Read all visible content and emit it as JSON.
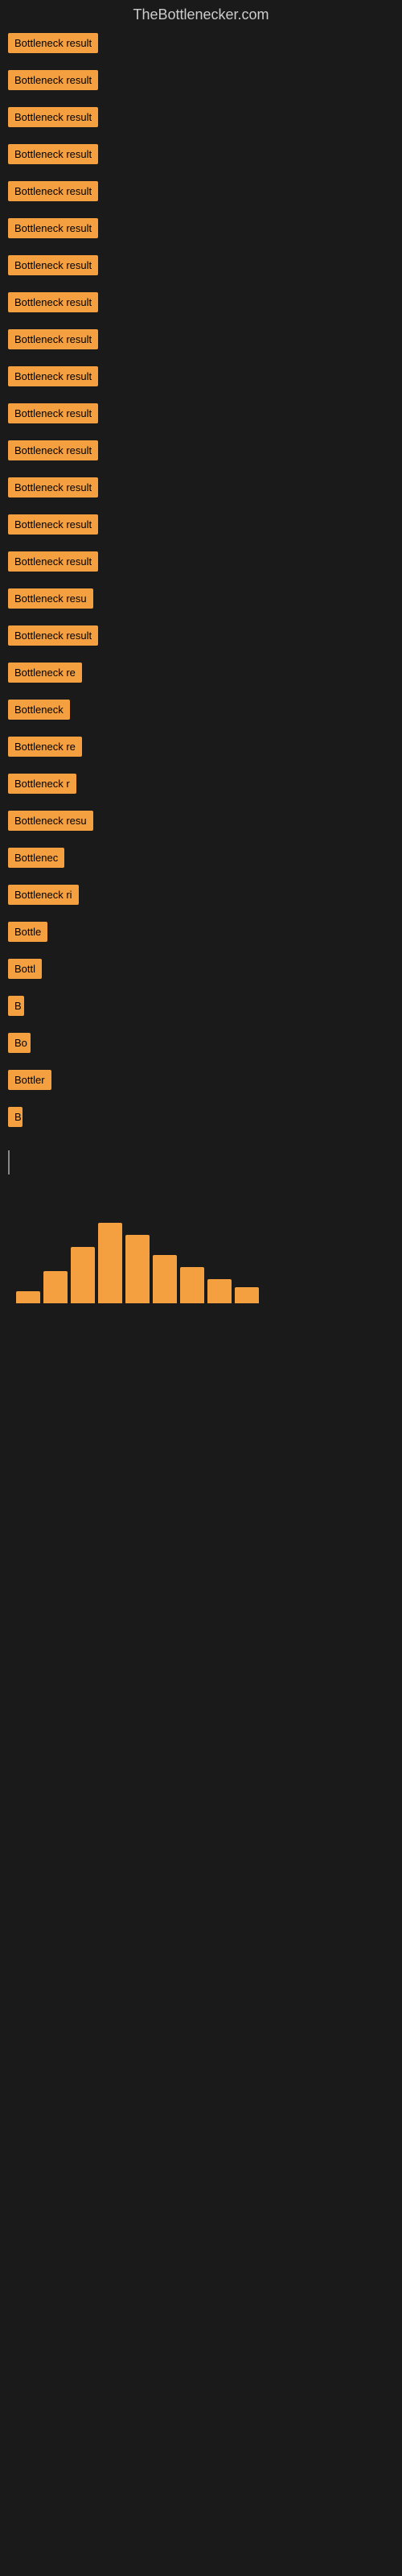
{
  "site": {
    "title": "TheBottlenecker.com"
  },
  "items": [
    {
      "id": 1,
      "label": "Bottleneck result",
      "width": 130,
      "visible_text": "Bottleneck result"
    },
    {
      "id": 2,
      "label": "Bottleneck result",
      "width": 130,
      "visible_text": "Bottleneck result"
    },
    {
      "id": 3,
      "label": "Bottleneck result",
      "width": 130,
      "visible_text": "Bottleneck result"
    },
    {
      "id": 4,
      "label": "Bottleneck result",
      "width": 130,
      "visible_text": "Bottleneck result"
    },
    {
      "id": 5,
      "label": "Bottleneck result",
      "width": 130,
      "visible_text": "Bottleneck result"
    },
    {
      "id": 6,
      "label": "Bottleneck result",
      "width": 130,
      "visible_text": "Bottleneck result"
    },
    {
      "id": 7,
      "label": "Bottleneck result",
      "width": 130,
      "visible_text": "Bottleneck result"
    },
    {
      "id": 8,
      "label": "Bottleneck result",
      "width": 130,
      "visible_text": "Bottleneck result"
    },
    {
      "id": 9,
      "label": "Bottleneck result",
      "width": 130,
      "visible_text": "Bottleneck result"
    },
    {
      "id": 10,
      "label": "Bottleneck result",
      "width": 130,
      "visible_text": "Bottleneck result"
    },
    {
      "id": 11,
      "label": "Bottleneck result",
      "width": 130,
      "visible_text": "Bottleneck result"
    },
    {
      "id": 12,
      "label": "Bottleneck result",
      "width": 130,
      "visible_text": "Bottleneck result"
    },
    {
      "id": 13,
      "label": "Bottleneck result",
      "width": 130,
      "visible_text": "Bottleneck result"
    },
    {
      "id": 14,
      "label": "Bottleneck result",
      "width": 130,
      "visible_text": "Bottleneck result"
    },
    {
      "id": 15,
      "label": "Bottleneck result",
      "width": 130,
      "visible_text": "Bottleneck result"
    },
    {
      "id": 16,
      "label": "Bottleneck resu",
      "width": 110,
      "visible_text": "Bottleneck resu"
    },
    {
      "id": 17,
      "label": "Bottleneck result",
      "width": 130,
      "visible_text": "Bottleneck result"
    },
    {
      "id": 18,
      "label": "Bottleneck re",
      "width": 100,
      "visible_text": "Bottleneck re"
    },
    {
      "id": 19,
      "label": "Bottleneck",
      "width": 80,
      "visible_text": "Bottleneck"
    },
    {
      "id": 20,
      "label": "Bottleneck re",
      "width": 100,
      "visible_text": "Bottleneck re"
    },
    {
      "id": 21,
      "label": "Bottleneck r",
      "width": 90,
      "visible_text": "Bottleneck r"
    },
    {
      "id": 22,
      "label": "Bottleneck resu",
      "width": 110,
      "visible_text": "Bottleneck resu"
    },
    {
      "id": 23,
      "label": "Bottlenec",
      "width": 75,
      "visible_text": "Bottlenec"
    },
    {
      "id": 24,
      "label": "Bottleneck ri",
      "width": 95,
      "visible_text": "Bottleneck ri"
    },
    {
      "id": 25,
      "label": "Bottle",
      "width": 55,
      "visible_text": "Bottle"
    },
    {
      "id": 26,
      "label": "Bottl",
      "width": 48,
      "visible_text": "Bottl"
    },
    {
      "id": 27,
      "label": "B",
      "width": 20,
      "visible_text": "B"
    },
    {
      "id": 28,
      "label": "Bo",
      "width": 28,
      "visible_text": "Bo"
    },
    {
      "id": 29,
      "label": "Bottler",
      "width": 60,
      "visible_text": "Bottler"
    },
    {
      "id": 30,
      "label": "B",
      "width": 18,
      "visible_text": "B"
    }
  ],
  "chart": {
    "bars": [
      15,
      40,
      70,
      100,
      85,
      60,
      45,
      30,
      20
    ]
  },
  "cursor": {
    "visible": true
  }
}
